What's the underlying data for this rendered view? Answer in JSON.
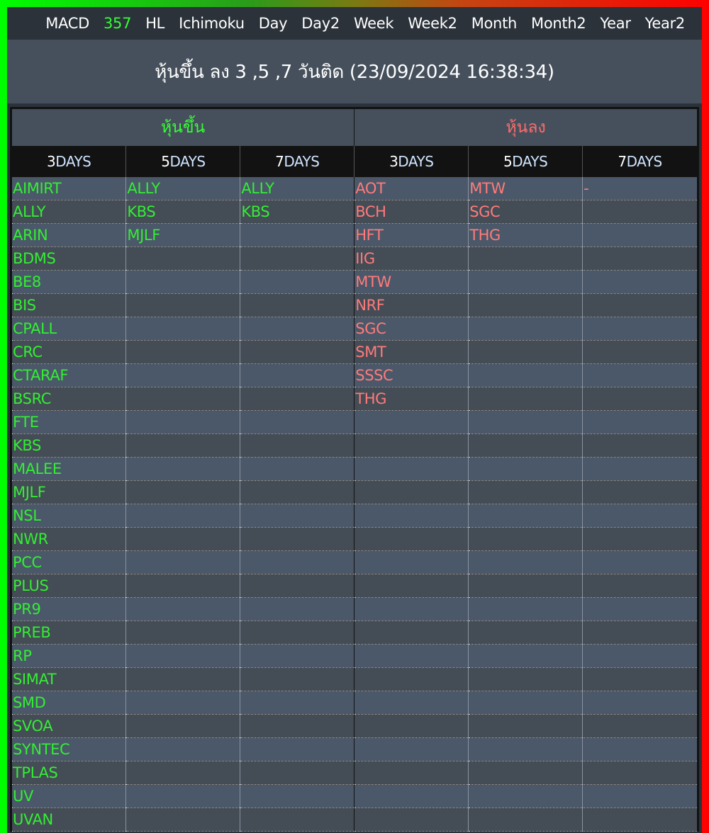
{
  "nav": {
    "items": [
      "MACD",
      "357",
      "HL",
      "Ichimoku",
      "Day",
      "Day2",
      "Week",
      "Week2",
      "Month",
      "Month2",
      "Year",
      "Year2"
    ],
    "active_index": 1
  },
  "title": "หุ้นขึ้น ลง 3 ,5 ,7 วันติด (23/09/2024 16:38:34)",
  "table": {
    "up_group_label": "หุ้นขึ้น",
    "down_group_label": "หุ้นลง",
    "day_headers": [
      {
        "num": "3",
        "unit": "DAYS"
      },
      {
        "num": "5",
        "unit": "DAYS"
      },
      {
        "num": "7",
        "unit": "DAYS"
      },
      {
        "num": "3",
        "unit": "DAYS"
      },
      {
        "num": "5",
        "unit": "DAYS"
      },
      {
        "num": "7",
        "unit": "DAYS"
      }
    ],
    "up_3days": [
      "AIMIRT",
      "ALLY",
      "ARIN",
      "BDMS",
      "BE8",
      "BIS",
      "CPALL",
      "CRC",
      "CTARAF",
      "BSRC",
      "FTE",
      "KBS",
      "MALEE",
      "MJLF",
      "NSL",
      "NWR",
      "PCC",
      "PLUS",
      "PR9",
      "PREB",
      "RP",
      "SIMAT",
      "SMD",
      "SVOA",
      "SYNTEC",
      "TPLAS",
      "UV",
      "UVAN"
    ],
    "up_5days": [
      "ALLY",
      "KBS",
      "MJLF"
    ],
    "up_7days": [
      "ALLY",
      "KBS"
    ],
    "down_3days": [
      "AOT",
      "BCH",
      "HFT",
      "IIG",
      "MTW",
      "NRF",
      "SGC",
      "SMT",
      "SSSC",
      "THG"
    ],
    "down_5days": [
      "MTW",
      "SGC",
      "THG"
    ],
    "down_7days": [
      "-"
    ]
  },
  "colors": {
    "up": "#33ee33",
    "down": "#ff7b7b",
    "nav_active": "#33ff33"
  }
}
